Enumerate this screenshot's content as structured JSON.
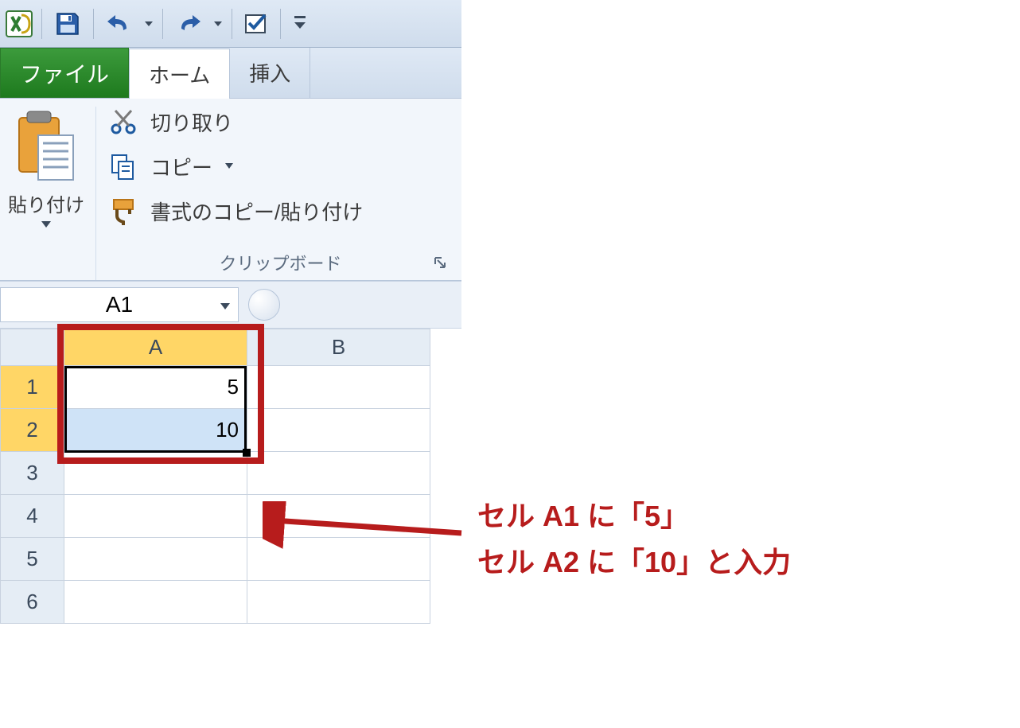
{
  "qat": {
    "tooltip_save": "save",
    "tooltip_undo": "undo",
    "tooltip_redo": "redo",
    "tooltip_check": "check"
  },
  "tabs": {
    "file": "ファイル",
    "home": "ホーム",
    "insert": "挿入"
  },
  "ribbon": {
    "paste": "貼り付け",
    "cut": "切り取り",
    "copy": "コピー",
    "format_painter": "書式のコピー/貼り付け",
    "group_label": "クリップボード"
  },
  "namebox": {
    "value": "A1"
  },
  "columns": [
    "A",
    "B"
  ],
  "rows": [
    "1",
    "2",
    "3",
    "4",
    "5",
    "6"
  ],
  "cells": {
    "A1": "5",
    "A2": "10"
  },
  "annotation": {
    "line1": "セル A1 に「5」",
    "line2": "セル A2 に「10」と入力"
  }
}
